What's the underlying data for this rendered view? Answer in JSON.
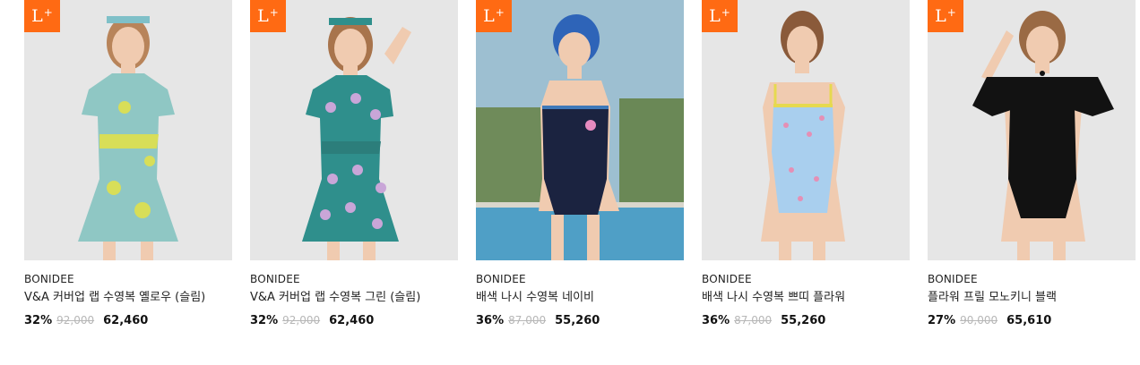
{
  "products": [
    {
      "badge": "L",
      "brand": "BONIDEE",
      "name": "V&A 커버업 랩 수영복 옐로우 (슬림)",
      "discount": "32%",
      "original_price": "92,000",
      "sale_price": "62,460",
      "colors": {
        "bg": "#e6e6e6",
        "garment": "#8fc7c4",
        "accent": "#d8de58"
      }
    },
    {
      "badge": "L",
      "brand": "BONIDEE",
      "name": "V&A 커버업 랩 수영복 그린 (슬림)",
      "discount": "32%",
      "original_price": "92,000",
      "sale_price": "62,460",
      "colors": {
        "bg": "#e6e6e6",
        "garment": "#2f8f8c",
        "accent": "#c9a6d8"
      }
    },
    {
      "badge": "L",
      "brand": "BONIDEE",
      "name": "배색 나시 수영복 네이비",
      "discount": "36%",
      "original_price": "87,000",
      "sale_price": "55,260",
      "colors": {
        "bg": "#9dbfd1",
        "garment": "#1b2340",
        "accent": "#3f79b9"
      }
    },
    {
      "badge": "L",
      "brand": "BONIDEE",
      "name": "배색 나시 수영복 쁘띠 플라워",
      "discount": "36%",
      "original_price": "87,000",
      "sale_price": "55,260",
      "colors": {
        "bg": "#e6e6e6",
        "garment": "#a9cfee",
        "accent": "#e6d94f"
      }
    },
    {
      "badge": "L",
      "brand": "BONIDEE",
      "name": "플라워 프릴 모노키니 블랙",
      "discount": "27%",
      "original_price": "90,000",
      "sale_price": "65,610",
      "colors": {
        "bg": "#e6e6e6",
        "garment": "#121212",
        "accent": "#121212"
      }
    }
  ]
}
